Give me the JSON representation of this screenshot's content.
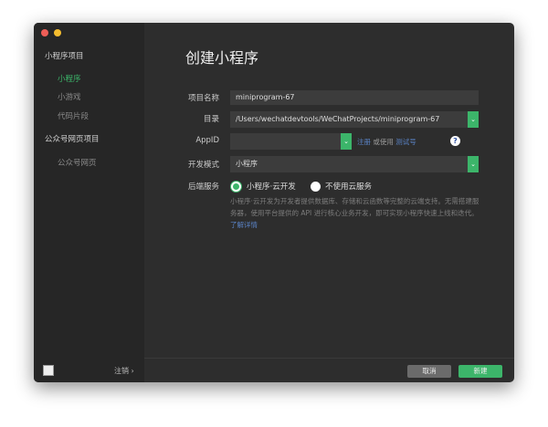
{
  "colors": {
    "accent": "#3cb56a",
    "link": "#5a83c6",
    "close": "#ee5e57",
    "minimize": "#f5bd2f"
  },
  "sidebar": {
    "groups": [
      {
        "label": "小程序项目",
        "items": [
          {
            "label": "小程序",
            "active": true
          },
          {
            "label": "小游戏"
          },
          {
            "label": "代码片段"
          }
        ]
      },
      {
        "label": "公众号网页项目",
        "items": [
          {
            "label": "公众号网页"
          }
        ]
      }
    ],
    "logout": "注销 ›"
  },
  "main": {
    "title": "创建小程序",
    "form": {
      "name": {
        "label": "项目名称",
        "value": "miniprogram-67"
      },
      "dir": {
        "label": "目录",
        "value": "/Users/wechatdevtools/WeChatProjects/miniprogram-67"
      },
      "appid": {
        "label": "AppID",
        "value": "",
        "register": "注册",
        "or_use": "或使用",
        "test_account": "测试号",
        "help": "?"
      },
      "mode": {
        "label": "开发模式",
        "value": "小程序"
      },
      "backend": {
        "label": "后端服务",
        "options": [
          {
            "label": "小程序·云开发",
            "selected": true
          },
          {
            "label": "不使用云服务",
            "selected": false
          }
        ],
        "description": "小程序·云开发为开发者提供数据库、存储和云函数等完整的云端支持。无需搭建服务器，使用平台提供的 API 进行核心业务开发，即可实现小程序快速上线和迭代。",
        "learn_more": "了解详情"
      }
    },
    "buttons": {
      "cancel": "取消",
      "create": "新建"
    }
  }
}
